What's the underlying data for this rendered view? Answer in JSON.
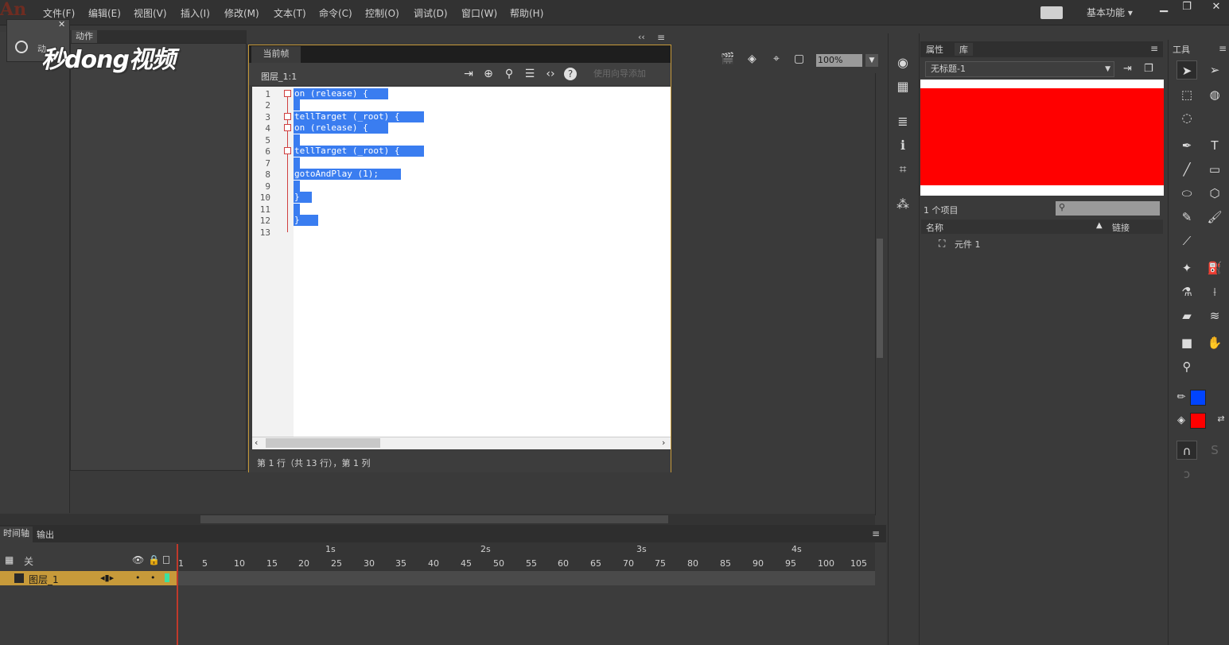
{
  "app": {
    "logo": "An"
  },
  "menu": [
    "文件(F)",
    "编辑(E)",
    "视图(V)",
    "插入(I)",
    "修改(M)",
    "文本(T)",
    "命令(C)",
    "控制(O)",
    "调试(D)",
    "窗口(W)",
    "帮助(H)"
  ],
  "workspace": "基本功能",
  "actions_panel": {
    "tab": "动作",
    "side_label": "动"
  },
  "watermark": "秒dong视频",
  "editor": {
    "tab": "当前帧",
    "path": "图层_1:1",
    "hint_button": "使用向导添加",
    "status": "第 1 行（共 13 行），第 1 列",
    "line_numbers": [
      "1",
      "2",
      "3",
      "4",
      "5",
      "6",
      "7",
      "8",
      "9",
      "10",
      "11",
      "12",
      "13"
    ],
    "code": [
      "on (release) {",
      "",
      "tellTarget (_root) {",
      "on (release) {",
      "",
      "tellTarget (_root) {",
      "",
      "gotoAndPlay (1);",
      "",
      "}",
      "",
      "}",
      ""
    ]
  },
  "stage": {
    "zoom": "100%"
  },
  "timeline": {
    "tabs": [
      "时间轴",
      "输出"
    ],
    "layer_group": "关",
    "layer_name": "图层_1",
    "ticks": [
      "1",
      "5",
      "10",
      "15",
      "20",
      "25",
      "30",
      "35",
      "40",
      "45",
      "50",
      "55",
      "60",
      "65",
      "70",
      "75",
      "80",
      "85",
      "90",
      "95",
      "100",
      "105"
    ],
    "seconds": [
      "1s",
      "2s",
      "3s",
      "4s"
    ]
  },
  "library": {
    "tabs": [
      "属性",
      "库"
    ],
    "document": "无标题-1",
    "count": "1 个项目",
    "col_name": "名称",
    "col_link": "链接",
    "items": [
      "元件 1"
    ]
  },
  "tools": {
    "title": "工具",
    "stroke_color": "#0044ff",
    "fill_color": "#ff0000"
  },
  "colors": {
    "selection": "#3a7df0",
    "accent": "#c79a3a"
  }
}
